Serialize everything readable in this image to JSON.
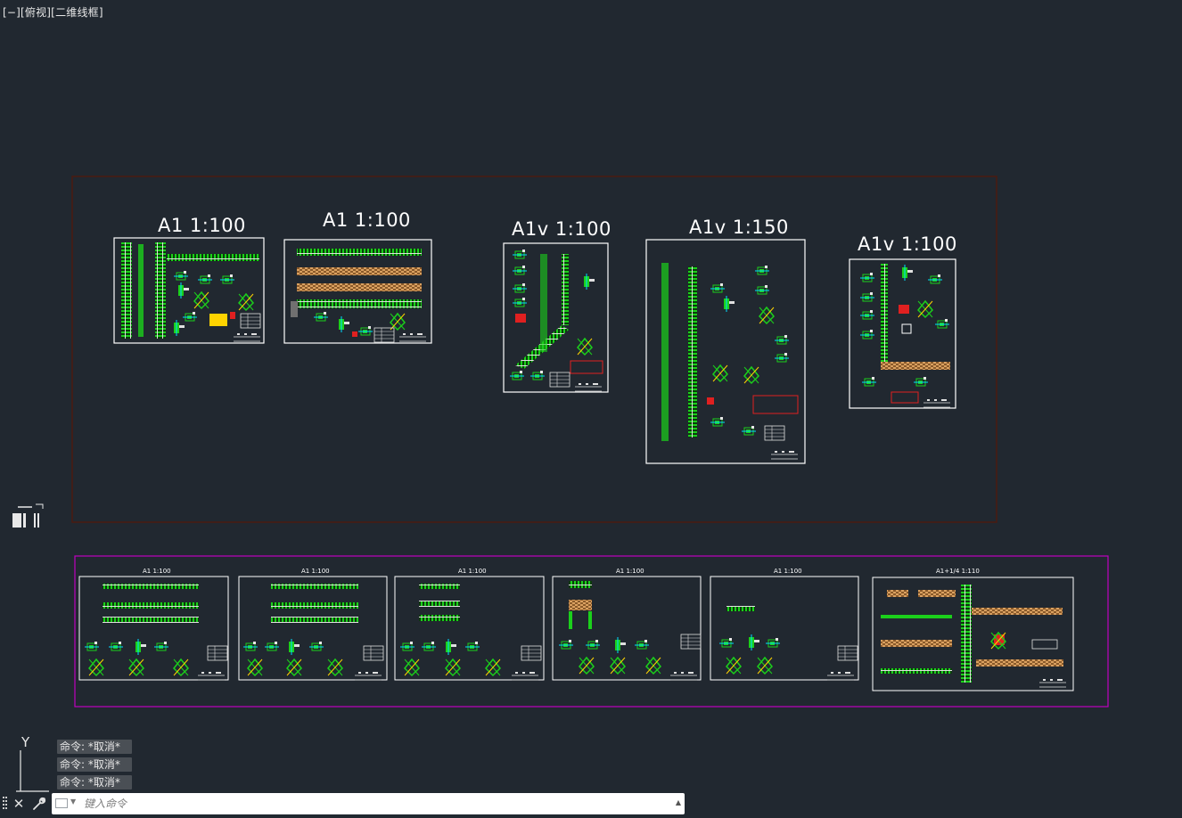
{
  "viewport": {
    "label": "[−][俯视][二维线框]"
  },
  "sheets_top": [
    {
      "title": "A1  1:100"
    },
    {
      "title": "A1  1:100"
    },
    {
      "title": "A1v  1:100"
    },
    {
      "title": "A1v  1:150"
    },
    {
      "title": "A1v  1:100"
    }
  ],
  "sheets_bottom": [
    {
      "title": "A1 1:100"
    },
    {
      "title": "A1 1:100"
    },
    {
      "title": "A1 1:100"
    },
    {
      "title": "A1 1:100"
    },
    {
      "title": "A1 1:100"
    },
    {
      "title": "A1+1/4   1:110"
    }
  ],
  "ucs": {
    "y_label": "Y"
  },
  "command_history": [
    "命令: *取消*",
    "命令: *取消*",
    "命令: *取消*"
  ],
  "command_line": {
    "placeholder": "键入命令",
    "close_icon": "close-icon",
    "customize_icon": "wrench-icon"
  },
  "colors": {
    "background": "#212830",
    "top_frame": "#4a1a10",
    "bottom_frame": "#c000c0",
    "drawing_green": "#18d018",
    "sheet_border": "#ffffff"
  }
}
